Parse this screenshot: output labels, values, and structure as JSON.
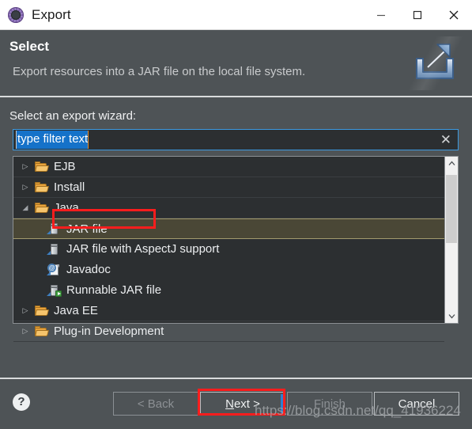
{
  "window": {
    "title": "Export",
    "icon": "eclipse-wizard-icon",
    "controls": {
      "minimize": "minimize-icon",
      "maximize": "maximize-icon",
      "close": "close-icon"
    }
  },
  "header": {
    "title": "Select",
    "description": "Export resources into a JAR file on the local file system.",
    "banner_icon": "export-arrow-icon"
  },
  "main": {
    "section_label": "Select an export wizard:",
    "filter": {
      "value": "type filter text",
      "placeholder": "type filter text",
      "clear_icon": "clear-x-icon",
      "selected": true
    },
    "tree": {
      "items": [
        {
          "label": "EJB",
          "icon": "folder-icon",
          "level": 0,
          "expanded": false,
          "twisty": "▷",
          "selected": false
        },
        {
          "label": "Install",
          "icon": "folder-icon",
          "level": 0,
          "expanded": false,
          "twisty": "▷",
          "selected": false
        },
        {
          "label": "Java",
          "icon": "folder-icon",
          "level": 0,
          "expanded": true,
          "twisty": "◢",
          "selected": false
        },
        {
          "label": "JAR file",
          "icon": "jar-icon",
          "level": 1,
          "expanded": false,
          "twisty": "",
          "selected": true
        },
        {
          "label": "JAR file with AspectJ support",
          "icon": "jar-icon",
          "level": 1,
          "expanded": false,
          "twisty": "",
          "selected": false
        },
        {
          "label": "Javadoc",
          "icon": "javadoc-icon",
          "level": 1,
          "expanded": false,
          "twisty": "",
          "selected": false
        },
        {
          "label": "Runnable JAR file",
          "icon": "runnable-jar-icon",
          "level": 1,
          "expanded": false,
          "twisty": "",
          "selected": false
        },
        {
          "label": "Java EE",
          "icon": "folder-icon",
          "level": 0,
          "expanded": false,
          "twisty": "▷",
          "selected": false
        },
        {
          "label": "Plug-in Development",
          "icon": "folder-icon",
          "level": 0,
          "expanded": false,
          "twisty": "▷",
          "selected": false
        }
      ],
      "scrollbar": {
        "up_arrow": "▲",
        "down_arrow": "▼"
      }
    }
  },
  "footer": {
    "help_icon": "?",
    "buttons": {
      "back": {
        "label": "< Back",
        "enabled": false
      },
      "next_prefix": "",
      "next_mnemonic": "N",
      "next_suffix": "ext >",
      "finish": {
        "label": "Finish",
        "enabled": false
      },
      "cancel": {
        "label": "Cancel",
        "enabled": true
      }
    }
  },
  "annotations": {
    "watermark": "https://blog.csdn.net/qq_41936224",
    "highlight_color": "#fa1d1d",
    "boxes": [
      "jar-file-row",
      "next-button"
    ]
  },
  "colors": {
    "dialog_bg": "#4e5356",
    "titlebar_bg": "#ffffff",
    "field_bg": "#2c2f31",
    "focus_border": "#3d9ae0",
    "selection_blue": "#1572c9",
    "row_selected_bg": "#4a4736",
    "annotation_red": "#fa1d1d"
  }
}
